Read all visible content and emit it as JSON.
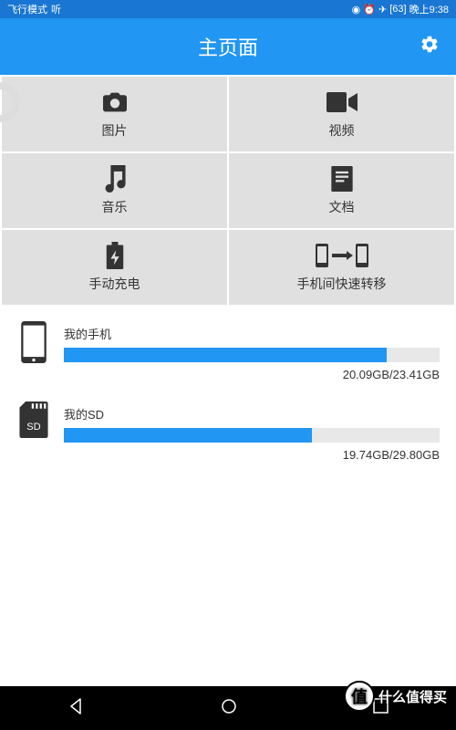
{
  "status": {
    "mode_label": "飞行模式",
    "listen": "听",
    "battery": "63",
    "time": "晚上9:38"
  },
  "header": {
    "title": "主页面"
  },
  "grid": {
    "photo": "图片",
    "video": "视频",
    "music": "音乐",
    "doc": "文档",
    "charge": "手动充电",
    "transfer": "手机间快速转移"
  },
  "storage": {
    "phone": {
      "label": "我的手机",
      "used": "20.09GB",
      "total": "23.41GB",
      "percent": 86
    },
    "sd": {
      "label": "我的SD",
      "used": "19.74GB",
      "total": "29.80GB",
      "percent": 66
    }
  },
  "watermark": "什么值得买",
  "watermark_badge": "值"
}
